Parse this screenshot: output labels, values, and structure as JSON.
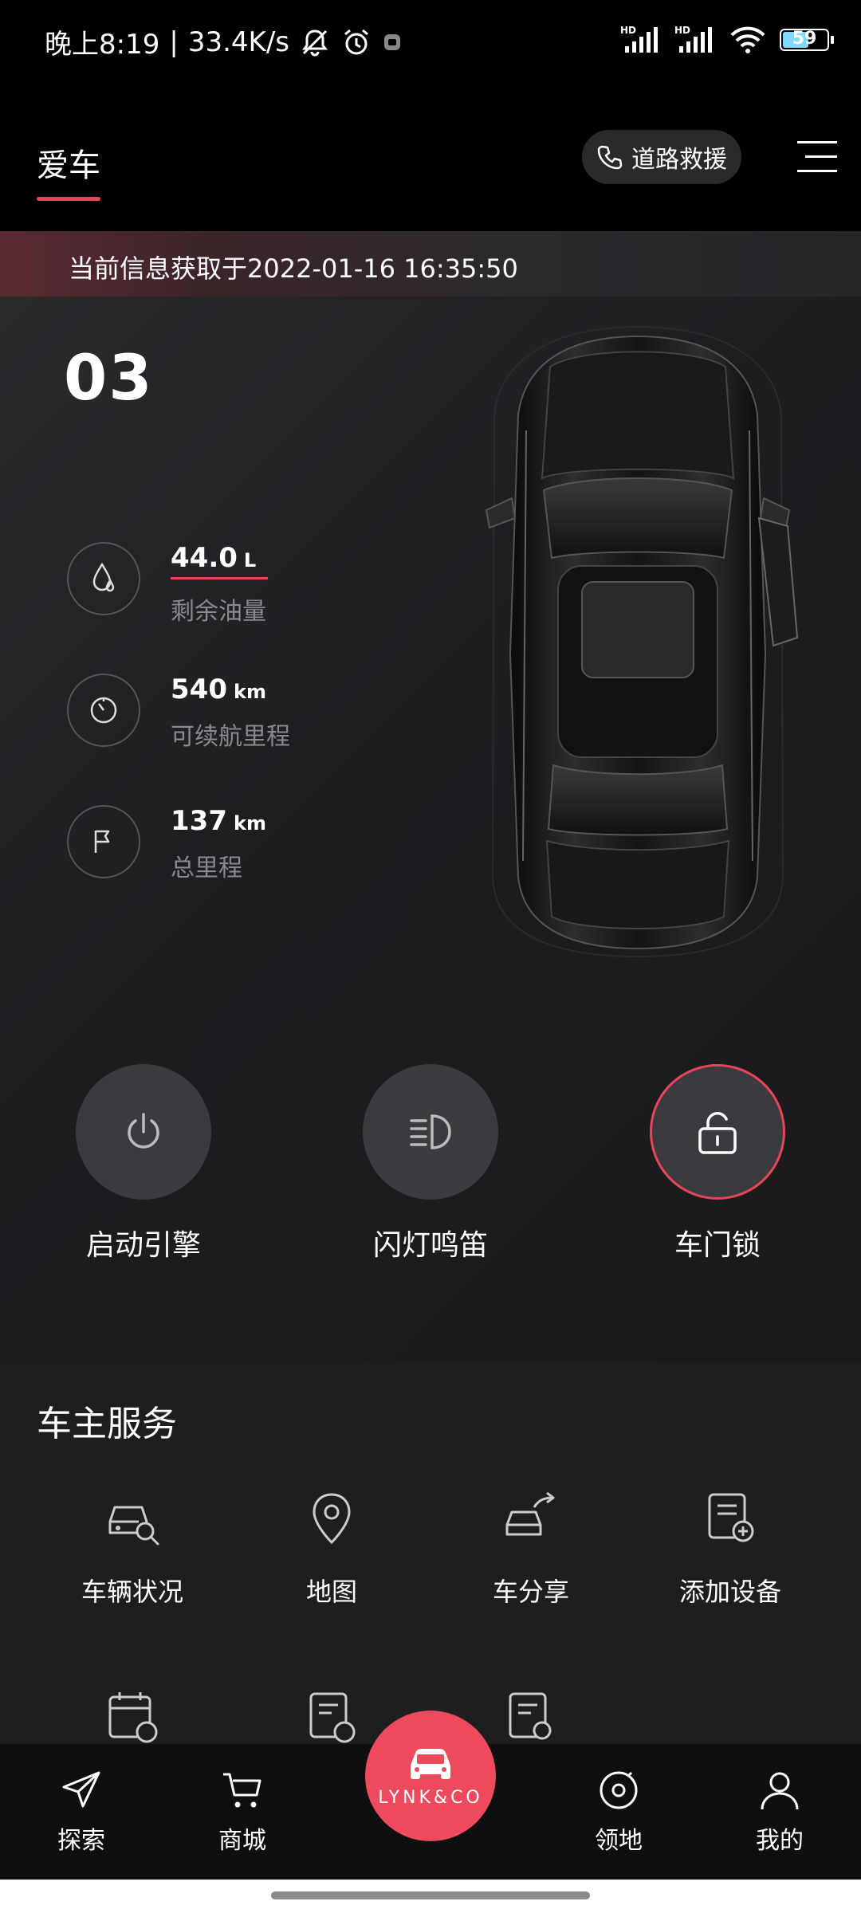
{
  "status_bar": {
    "time": "晚上8:19",
    "net_speed": "33.4K/s",
    "battery": "59",
    "battery_level": 0.59
  },
  "header": {
    "tab_label": "爱车",
    "rescue_label": "道路救援"
  },
  "info": {
    "update_text": "当前信息获取于2022-01-16 16:35:50"
  },
  "vehicle": {
    "model": "03",
    "stats": [
      {
        "value": "44.0",
        "unit": "L",
        "label": "剩余油量"
      },
      {
        "value": "540",
        "unit": "km",
        "label": "可续航里程"
      },
      {
        "value": "137",
        "unit": "km",
        "label": "总里程"
      }
    ]
  },
  "controls": [
    {
      "label": "启动引擎"
    },
    {
      "label": "闪灯鸣笛"
    },
    {
      "label": "车门锁"
    }
  ],
  "services": {
    "title": "车主服务",
    "items": [
      {
        "label": "车辆状况"
      },
      {
        "label": "地图"
      },
      {
        "label": "车分享"
      },
      {
        "label": "添加设备"
      }
    ]
  },
  "bottom_nav": {
    "items": [
      {
        "label": "探索"
      },
      {
        "label": "商城"
      },
      {
        "label": "领地"
      },
      {
        "label": "我的"
      }
    ],
    "center_brand": "LYNK&CO"
  },
  "colors": {
    "accent": "#e8455a",
    "background": "#1d1d20"
  }
}
